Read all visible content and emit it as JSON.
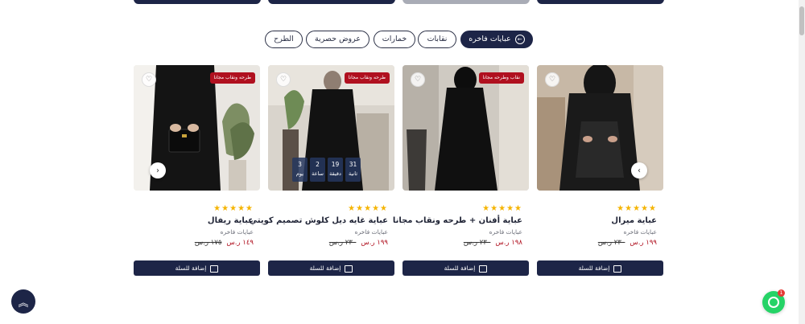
{
  "tabs": [
    {
      "label": "عبايات فاخره",
      "active": true
    },
    {
      "label": "نقابات",
      "active": false
    },
    {
      "label": "خمارات",
      "active": false
    },
    {
      "label": "عروض حصرية",
      "active": false
    },
    {
      "label": "الطرح",
      "active": false
    }
  ],
  "add_to_cart_label": "إضافة للسلة",
  "stars": "★★★★★",
  "countdown": {
    "seconds": "31",
    "seconds_label": "ثانية",
    "minutes": "19",
    "minutes_label": "دقيقة",
    "hours": "2",
    "hours_label": "ساعة",
    "days": "3",
    "days_label": "يوم"
  },
  "products": [
    {
      "name": "عباية ريفال",
      "category": "عبايات فاخره",
      "price_new": "١٤٩",
      "price_old": "١٧٥",
      "currency": "ر.س",
      "badge": "طرحه ونقاب مجانا"
    },
    {
      "name": "عباية غايه ديل كلوش تصميم كويتي",
      "category": "عبايات فاخره",
      "price_new": "١٩٩",
      "price_old": "٢٣٠",
      "currency": "ر.س",
      "badge": "طرحه ونقاب مجانا"
    },
    {
      "name": "عباية أفنان + طرحه ونقاب مجانا",
      "category": "عبايات فاخره",
      "price_new": "١٩٨",
      "price_old": "٢٣٠",
      "currency": "ر.س",
      "badge": "نقاب وطرحه مجانا"
    },
    {
      "name": "عباية ميرال",
      "category": "عبايات فاخره",
      "price_new": "١٩٩",
      "price_old": "٢٣٠",
      "currency": "ر.س",
      "badge": ""
    }
  ],
  "whatsapp_badge": "1",
  "colors": {
    "navy": "#1d2547",
    "red": "#b0101f",
    "star": "#f5b400",
    "whatsapp": "#25d366"
  }
}
